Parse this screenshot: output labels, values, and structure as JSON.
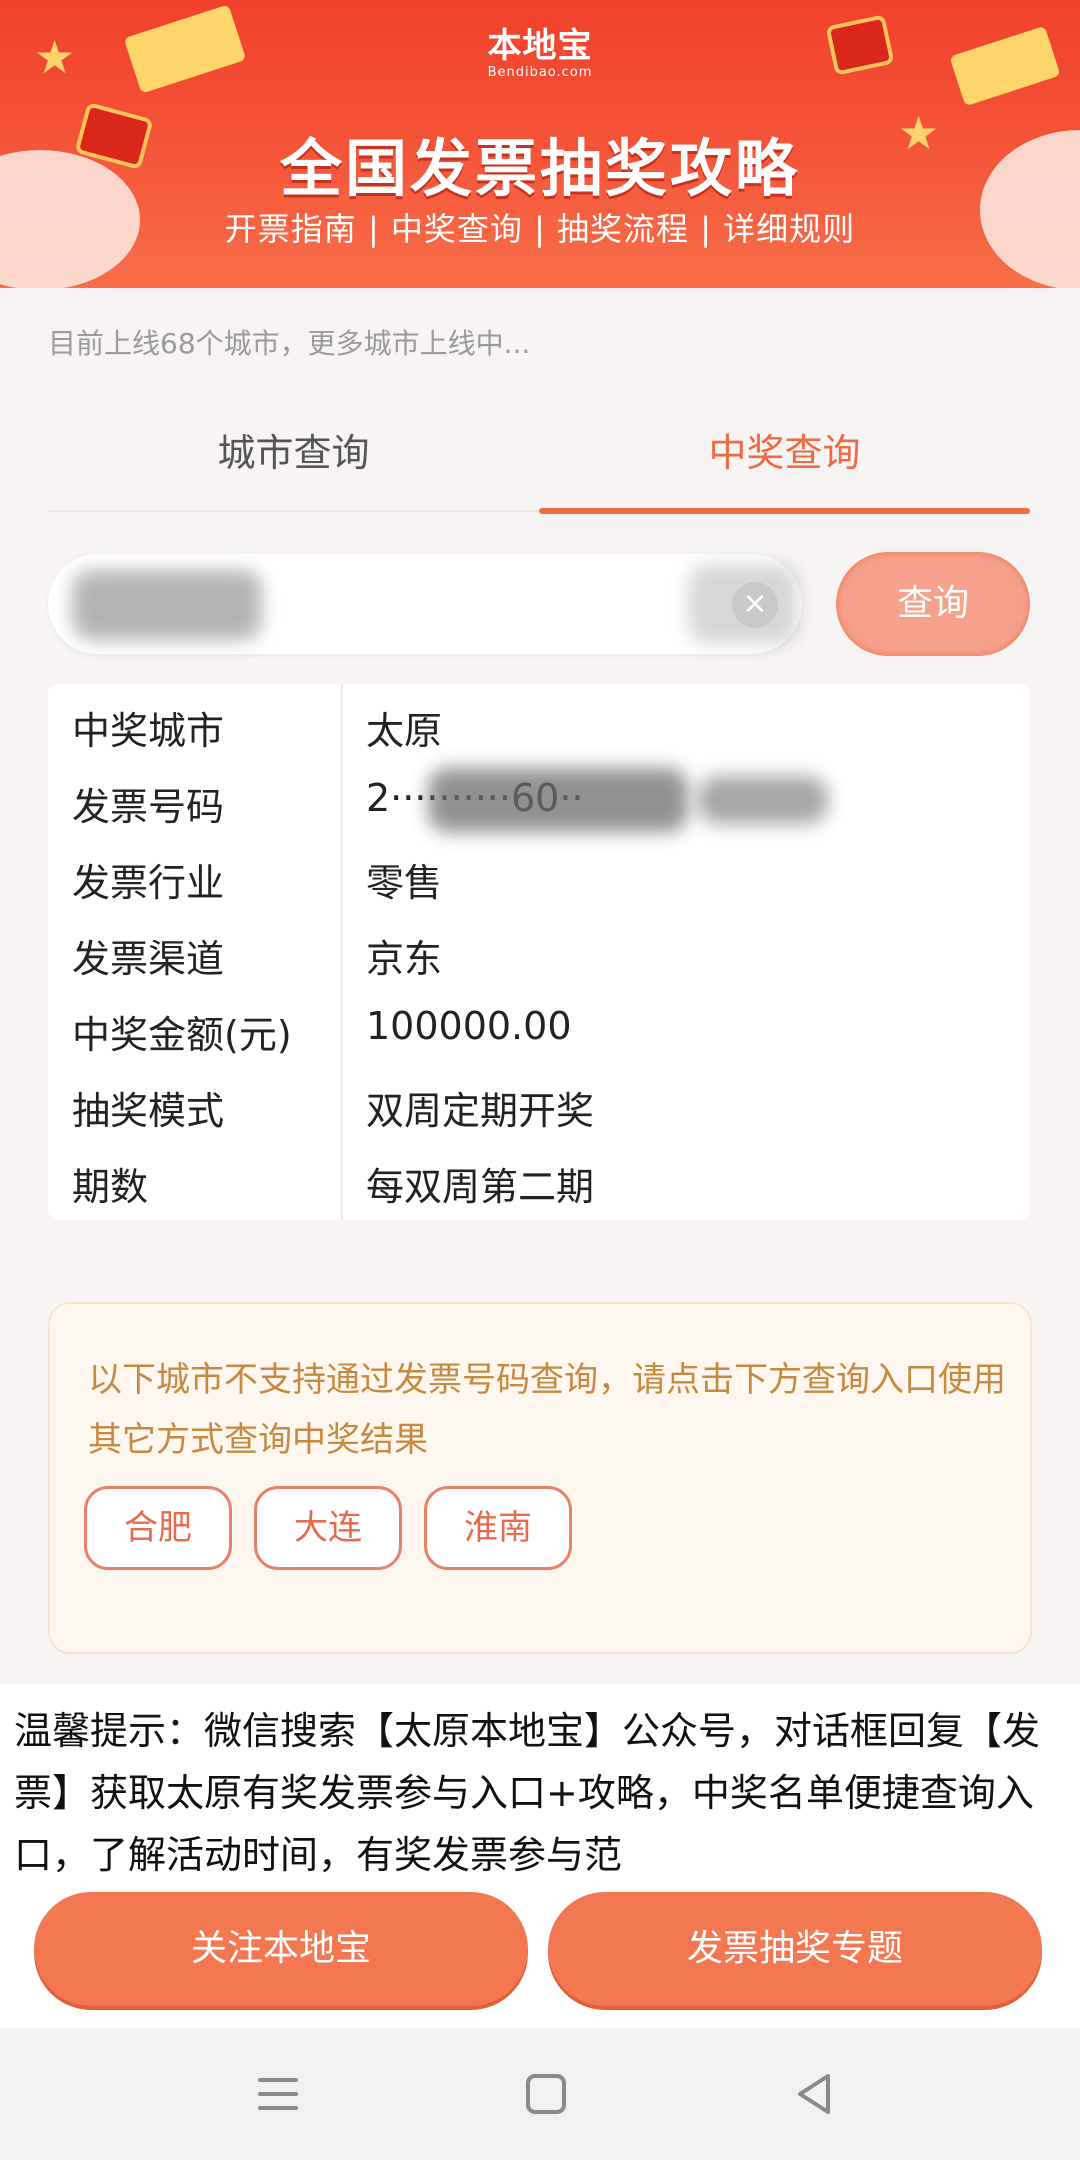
{
  "banner": {
    "logo_main": "本地宝",
    "logo_sub": "Bendibao.com",
    "title": "全国发票抽奖攻略",
    "subtitle": "开票指南 | 中奖查询 | 抽奖流程 | 详细规则"
  },
  "notice": "目前上线68个城市，更多城市上线中...",
  "tabs": [
    {
      "label": "城市查询",
      "active": false
    },
    {
      "label": "中奖查询",
      "active": true
    }
  ],
  "search": {
    "query_label": "查询"
  },
  "result": [
    {
      "key": "中奖城市",
      "value": "太原"
    },
    {
      "key": "发票号码",
      "value": "2··········60··"
    },
    {
      "key": "发票行业",
      "value": "零售"
    },
    {
      "key": "发票渠道",
      "value": "京东"
    },
    {
      "key": "中奖金额(元)",
      "value": "100000.00"
    },
    {
      "key": "抽奖模式",
      "value": "双周定期开奖"
    },
    {
      "key": "期数",
      "value": "每双周第二期"
    }
  ],
  "unsupported": {
    "message": "以下城市不支持通过发票号码查询，请点击下方查询入口使用其它方式查询中奖结果",
    "cities": [
      "合肥",
      "大连",
      "淮南"
    ]
  },
  "tip": "温馨提示：微信搜索【太原本地宝】公众号，对话框回复【发票】获取太原有奖发票参与入口+攻略，中奖名单便捷查询入口，了解活动时间，有奖发票参与范",
  "actions": {
    "follow": "关注本地宝",
    "topic": "发票抽奖专题"
  },
  "colors": {
    "brand": "#f0402b",
    "accent": "#ef6b43",
    "notice_text": "#c6893f"
  }
}
